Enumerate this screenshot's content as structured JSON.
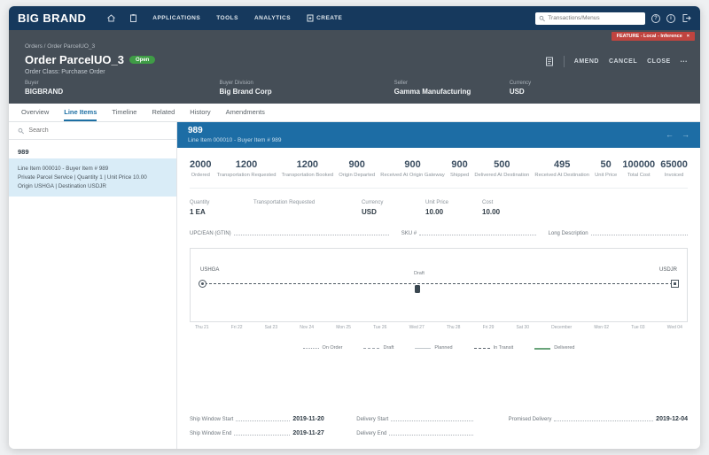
{
  "colors": {
    "navbar": "#16395d",
    "header": "#454e57",
    "accent_blue": "#1d6da5",
    "open_green": "#3f9c46",
    "feature_red": "#c0443f",
    "selected_item_blue": "#d9ecf7"
  },
  "navbar": {
    "brand": "BIG BRAND",
    "menu": [
      "APPLICATIONS",
      "TOOLS",
      "ANALYTICS",
      "CREATE"
    ],
    "search_placeholder": "Transactions/Menus"
  },
  "feature_badge": {
    "label": "FEATURE - Local - Inference",
    "close": "×"
  },
  "breadcrumb": "Orders  /  Order ParcelUO_3",
  "order": {
    "title": "Order ParcelUO_3",
    "status": "Open",
    "order_class": "Order Class: Purchase Order",
    "actions": [
      "AMEND",
      "CANCEL",
      "CLOSE"
    ],
    "more": "•••"
  },
  "order_fields": [
    {
      "label": "Buyer",
      "value": "BIGBRAND"
    },
    {
      "label": "Buyer Division",
      "value": "Big Brand Corp"
    },
    {
      "label": "Seller",
      "value": "Gamma Manufacturing"
    },
    {
      "label": "Currency",
      "value": "USD"
    }
  ],
  "tabs": [
    "Overview",
    "Line Items",
    "Timeline",
    "Related",
    "History",
    "Amendments"
  ],
  "left_panel": {
    "search_placeholder": "Search",
    "group_title": "989",
    "item": {
      "line1": "Line Item 000010 - Buyer Item # 989",
      "line2": "Private Parcel Service  |  Quantity 1  |  Unit Price 10.00",
      "line3": "Origin USHGA  |  Destination USDJR"
    }
  },
  "panel": {
    "title": "989",
    "subtitle": "Line Item 000010 - Buyer Item # 989",
    "prev": "←",
    "next": "→"
  },
  "metrics": [
    {
      "value": "2000",
      "label": "Ordered"
    },
    {
      "value": "1200",
      "label": "Transportation Requested"
    },
    {
      "value": "1200",
      "label": "Transportation Booked"
    },
    {
      "value": "900",
      "label": "Origin Departed"
    },
    {
      "value": "900",
      "label": "Received At Origin Gateway"
    },
    {
      "value": "900",
      "label": "Shipped"
    },
    {
      "value": "500",
      "label": "Delivered At Destination"
    },
    {
      "value": "495",
      "label": "Received At Destination"
    },
    {
      "value": "50",
      "label": "Unit Price"
    },
    {
      "value": "100000",
      "label": "Total Cost"
    },
    {
      "value": "65000",
      "label": "Invoiced"
    }
  ],
  "details": [
    {
      "label": "Quantity",
      "value": "1 EA"
    },
    {
      "label": "Transportation Requested",
      "value": ""
    },
    {
      "label": "Currency",
      "value": "USD"
    },
    {
      "label": "Unit Price",
      "value": "10.00"
    },
    {
      "label": "Cost",
      "value": "10.00"
    }
  ],
  "inline_fields": [
    "UPC/EAN (GTIN)",
    "SKU #",
    "Long Description"
  ],
  "chart_data": {
    "type": "timeline",
    "origin": "USHGA",
    "destination": "USDJR",
    "marker_label": "Draft",
    "ticks": [
      "Thu 21",
      "Fri 22",
      "Sat 23",
      "Nov 24",
      "Mon 25",
      "Tue 26",
      "Wed 27",
      "Thu 28",
      "Fri 29",
      "Sat 30",
      "December",
      "Mon 02",
      "Tue 03",
      "Wed 04"
    ],
    "legend": [
      "On Order",
      "Draft",
      "Planned",
      "In Transit",
      "Delivered"
    ]
  },
  "dates": [
    {
      "label": "Ship Window Start",
      "value": "2019-11-20"
    },
    {
      "label": "Delivery Start",
      "value": ""
    },
    {
      "label": "Promised Delivery",
      "value": "2019-12-04"
    },
    {
      "label": "Ship Window End",
      "value": "2019-11-27"
    },
    {
      "label": "Delivery End",
      "value": ""
    }
  ]
}
